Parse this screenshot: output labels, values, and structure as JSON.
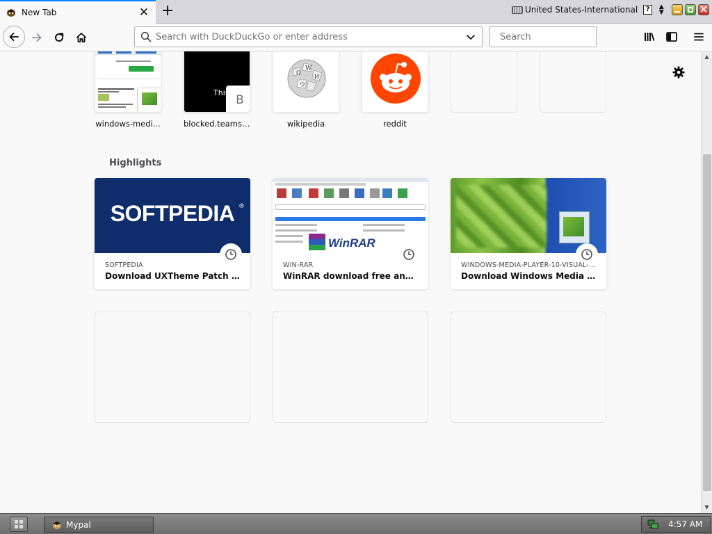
{
  "tab": {
    "title": "New Tab",
    "close_glyph": "✕"
  },
  "new_tab_glyph": "+",
  "ime": {
    "label": "United States-International",
    "help": "?",
    "arrows": "▲\n▼"
  },
  "urlbar": {
    "placeholder": "Search with DuckDuckGo or enter address"
  },
  "searchbar": {
    "placeholder": "Search"
  },
  "top_sites": [
    {
      "label": "windows-medi..."
    },
    {
      "label": "blocked.teams....",
      "letter": "B",
      "snippet": "This"
    },
    {
      "label": "wikipedia"
    },
    {
      "label": "reddit"
    },
    {
      "label": ""
    },
    {
      "label": ""
    }
  ],
  "highlights": {
    "title": "Highlights",
    "cards": [
      {
        "source": "SOFTPEDIA",
        "title": "Download UXTheme Patch For ...",
        "thumb_text": "SOFTPEDIA",
        "thumb_mark": "®"
      },
      {
        "source": "WIN-RAR",
        "title": "WinRAR download free and sup...",
        "thumb_text": "WinRAR"
      },
      {
        "source": "WINDOWS-MEDIA-PLAYER-10-VISUAL-ST...",
        "title": "Download Windows Media Playe..."
      }
    ]
  },
  "taskbar": {
    "task_label": "Mypal",
    "clock": "4:57 AM"
  },
  "colors": {
    "accent": "#0a84ff",
    "reddit": "#ff4500",
    "softpedia_bg": "#0f2d6b"
  }
}
